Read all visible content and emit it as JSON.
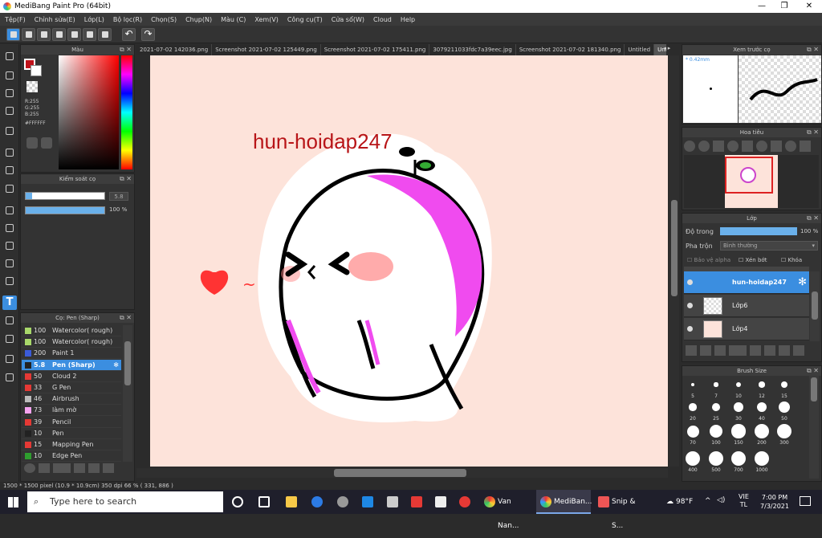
{
  "window": {
    "title": "MediBang Paint Pro (64bit)",
    "min": "—",
    "restore": "❐",
    "close": "✕"
  },
  "menu": [
    "Tệp(F)",
    "Chỉnh sửa(E)",
    "Lớp(L)",
    "Bộ lọc(R)",
    "Chọn(S)",
    "Chụp(N)",
    "Màu (C)",
    "Xem(V)",
    "Công cụ(T)",
    "Cửa sổ(W)",
    "Cloud",
    "Help"
  ],
  "color_panel": {
    "title": "Màu",
    "r": "R:255",
    "g": "G:255",
    "b": "B:255",
    "hex": "#FFFFFF",
    "primary": "#c0121a"
  },
  "brush_control": {
    "title": "Kiểm soát cọ",
    "size": "5.8",
    "opacity": "100 %"
  },
  "brush_list": {
    "title": "Cọ: Pen (Sharp)",
    "items": [
      {
        "size": "100",
        "name": "Watercolor( rough)",
        "color": "#a8d86a"
      },
      {
        "size": "100",
        "name": "Watercolor( rough)",
        "color": "#a8d86a"
      },
      {
        "size": "200",
        "name": "Paint 1",
        "color": "#3b5bd9"
      },
      {
        "size": "5.8",
        "name": "Pen (Sharp)",
        "color": "#222222"
      },
      {
        "size": "50",
        "name": "Cloud 2",
        "color": "#e53935"
      },
      {
        "size": "33",
        "name": "G Pen",
        "color": "#e53935"
      },
      {
        "size": "46",
        "name": "Airbrush",
        "color": "#bbbbbb"
      },
      {
        "size": "73",
        "name": "làm mờ",
        "color": "#f5a3f0"
      },
      {
        "size": "39",
        "name": "Pencil",
        "color": "#e53935"
      },
      {
        "size": "10",
        "name": "Pen",
        "color": "#222222"
      },
      {
        "size": "15",
        "name": "Mapping Pen",
        "color": "#e53935"
      },
      {
        "size": "10",
        "name": "Edge Pen",
        "color": "#2e9d2e"
      }
    ]
  },
  "tabs": [
    "2021-07-02 142036.png",
    "Screenshot 2021-07-02 125449.png",
    "Screenshot 2021-07-02 175411.png",
    "3079211033fdc7a39eec.jpg",
    "Screenshot 2021-07-02 181340.png",
    "Untitled",
    "Untitled"
  ],
  "canvas": {
    "text": "hun-hoidap247",
    "heart_tail": "~"
  },
  "preview": {
    "title": "Xem trước cọ",
    "size": "* 0.42mm"
  },
  "navigator": {
    "title": "Hoa tiêu"
  },
  "layers": {
    "title": "Lớp",
    "opacity_label": "Độ trong",
    "opacity": "100 %",
    "blend_label": "Pha trộn",
    "blend": "Bình thường",
    "protect": "Bảo vệ alpha",
    "clip": "Xén bớt",
    "lock": "Khóa",
    "items": [
      {
        "name": "hun-hoidap247"
      },
      {
        "name": "Lớp6"
      },
      {
        "name": "Lớp4"
      }
    ]
  },
  "brush_size": {
    "title": "Brush Size",
    "sizes": [
      "5",
      "7",
      "10",
      "12",
      "15",
      "20",
      "25",
      "30",
      "40",
      "50",
      "70",
      "100",
      "150",
      "200",
      "300",
      "400",
      "500",
      "700",
      "1000"
    ]
  },
  "status": "1500 * 1500 pixel  (10.9 * 10.9cm)  350 dpi  66 %  ( 331, 886 )",
  "taskbar": {
    "search": "Type here to search",
    "weather": "98°F",
    "lang1": "VIE",
    "lang2": "TL",
    "time": "7:00 PM",
    "date": "7/3/2021",
    "apps": [
      "Van Nan...",
      "MediBan...",
      "Snip & S..."
    ]
  }
}
